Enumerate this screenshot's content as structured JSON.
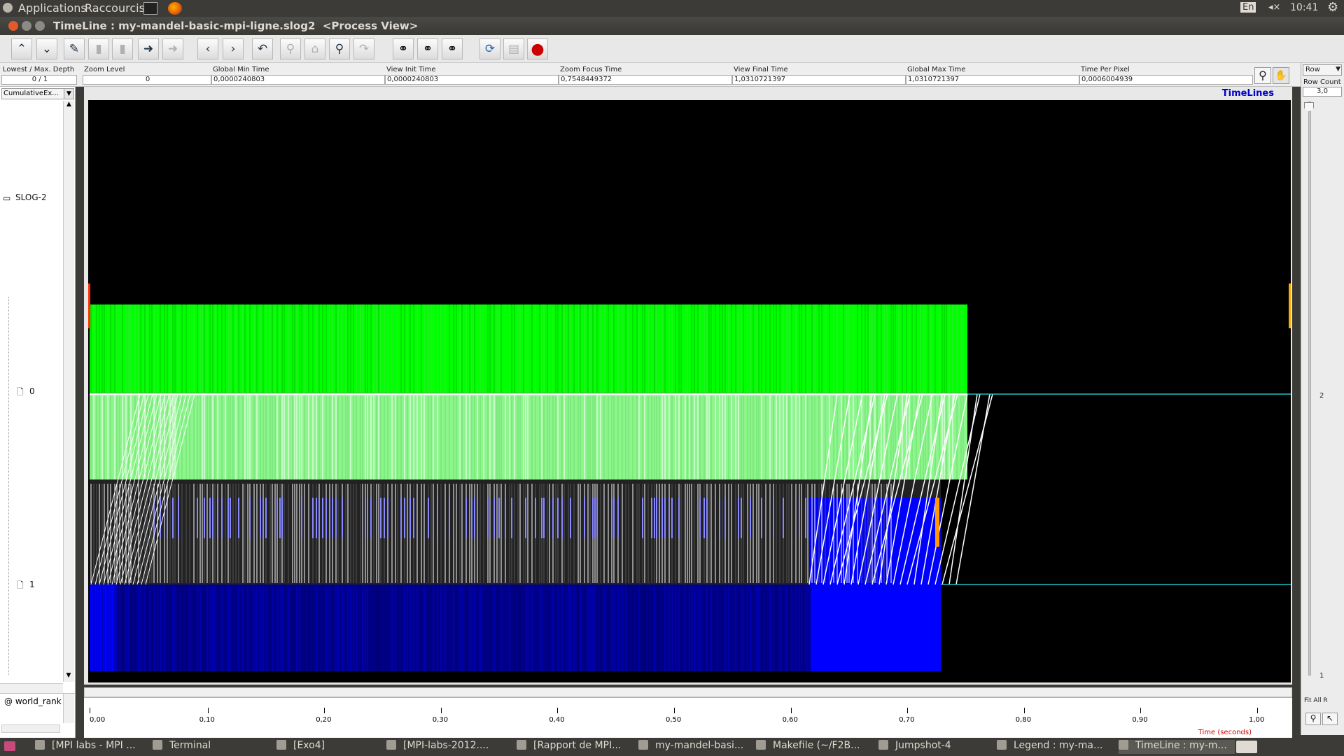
{
  "top_panel": {
    "applications": "Applications",
    "shortcuts": "Raccourcis",
    "keyboard": "En",
    "volume": "◂×",
    "clock": "10:41"
  },
  "window": {
    "title": "TimeLine : my-mandel-basic-mpi-ligne.slog2  <Process View>"
  },
  "toolbar": {
    "buttons": [
      {
        "name": "move-up",
        "glyph": "⌃"
      },
      {
        "name": "move-down",
        "glyph": "⌄"
      },
      {
        "name": "edit",
        "glyph": "✎"
      },
      {
        "name": "delete",
        "glyph": "▮"
      },
      {
        "name": "delete-all",
        "glyph": "▮"
      },
      {
        "name": "export",
        "glyph": "➜"
      },
      {
        "name": "import",
        "glyph": "➜"
      },
      {
        "name": "back",
        "glyph": "‹"
      },
      {
        "name": "forward",
        "glyph": "›"
      },
      {
        "name": "undo",
        "glyph": "↶"
      },
      {
        "name": "zoom-out",
        "glyph": "⚲"
      },
      {
        "name": "home",
        "glyph": "⌂"
      },
      {
        "name": "zoom-in",
        "glyph": "⚲"
      },
      {
        "name": "redo",
        "glyph": "↷"
      },
      {
        "name": "search-back",
        "glyph": "⚭"
      },
      {
        "name": "search",
        "glyph": "⚭"
      },
      {
        "name": "search-forward",
        "glyph": "⚭"
      },
      {
        "name": "refresh",
        "glyph": "⟳"
      },
      {
        "name": "print",
        "glyph": "▤"
      },
      {
        "name": "stop",
        "glyph": "●"
      }
    ]
  },
  "info": {
    "depth_label": "Lowest / Max. Depth",
    "depth_value": "0 / 1",
    "zoom_label": "Zoom Level",
    "zoom_value": "0",
    "gmin_label": "Global Min Time",
    "gmin_value": "0,0000240803",
    "vinit_label": "View  Init Time",
    "vinit_value": "0,0000240803",
    "focus_label": "Zoom Focus Time",
    "focus_value": "0,7548449372",
    "vfinal_label": "View Final Time",
    "vfinal_value": "1,0310721397",
    "gmax_label": "Global Max Time",
    "gmax_value": "1,0310721397",
    "tpp_label": "Time Per Pixel",
    "tpp_value": "0,0006004939"
  },
  "left_panel": {
    "combo": "CumulativeEx...",
    "root": "SLOG-2",
    "rows": [
      "0",
      "1"
    ],
    "footer": "@ world_rank"
  },
  "canvas": {
    "header": "TimeLines"
  },
  "right_panel": {
    "row_combo": "Row",
    "row_count_label": "Row Count",
    "row_count_value": "3,0",
    "tick_2": "2",
    "tick_1": "1",
    "fit_all": "Fit All R"
  },
  "ruler": {
    "ticks": [
      "0,00",
      "0,10",
      "0,20",
      "0,30",
      "0,40",
      "0,50",
      "0,60",
      "0,70",
      "0,80",
      "0,90",
      "1,00"
    ],
    "unit": "Time (seconds)"
  },
  "taskbar": {
    "items": [
      "[MPI labs - MPI ...",
      "Terminal",
      "[Exo4]",
      "[MPI-labs-2012....",
      "[Rapport de MPI...",
      "my-mandel-basi...",
      "Makefile (~/F2B...",
      "Jumpshot-4",
      "Legend : my-ma...",
      "TimeLine : my-m..."
    ]
  },
  "colors": {
    "compute": "#00ff00",
    "compute_light": "#8cf58c",
    "send": "#0000ff",
    "recv_dark": "#00008b",
    "message": "#ffffff",
    "rank_line": "#20c0c0",
    "accent_title": "#0000cc"
  }
}
